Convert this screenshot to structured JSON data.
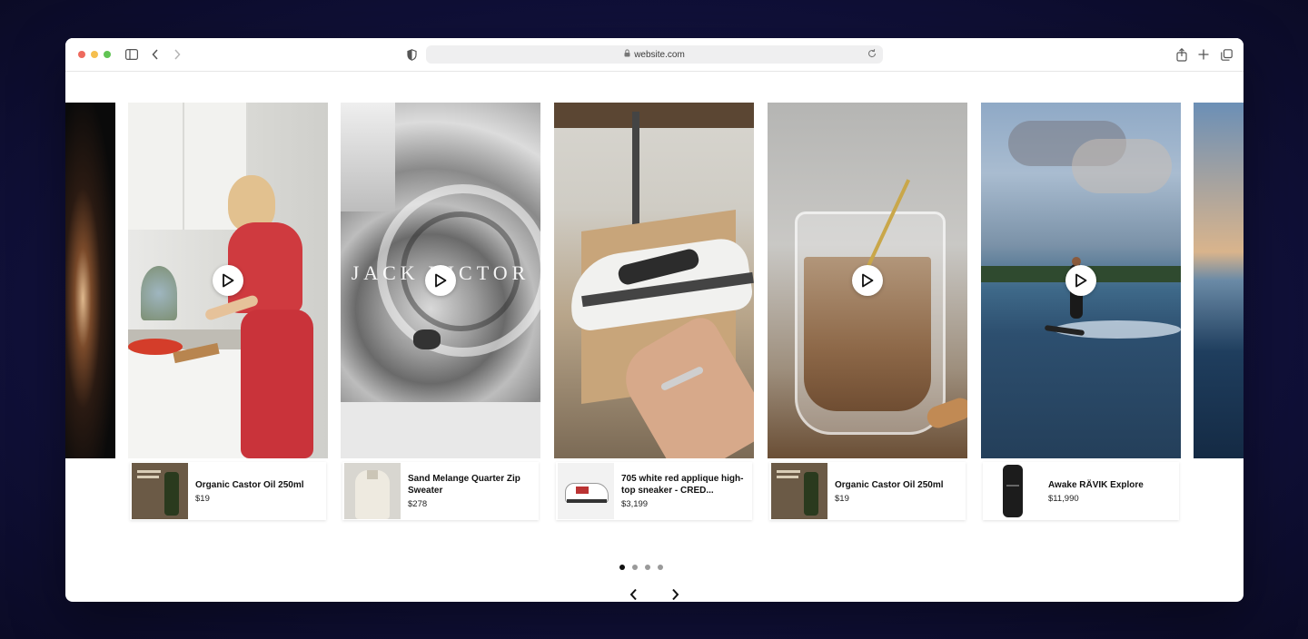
{
  "browser": {
    "url": "website.com",
    "traffic_colors": [
      "#ee6a5e",
      "#f5bf4f",
      "#61c454"
    ]
  },
  "icons": {
    "toolbar": [
      "sidebar-icon",
      "back-icon",
      "forward-icon",
      "shield-icon",
      "lock-icon",
      "reload-icon",
      "share-icon",
      "new-tab-icon",
      "tabs-overview-icon"
    ],
    "carousel": [
      "play-icon",
      "chevron-left-icon",
      "chevron-right-icon"
    ]
  },
  "cards": [
    {
      "media_label": "kitchen-video",
      "overlay_text": "",
      "product": {
        "name": "Organic Castor Oil 250ml",
        "price": "$19"
      }
    },
    {
      "media_label": "staircase-video",
      "overlay_text": "JACK VICTOR",
      "product": {
        "name": "Sand Melange Quarter Zip Sweater",
        "price": "$278"
      }
    },
    {
      "media_label": "sneaker-video",
      "overlay_text": "",
      "product": {
        "name": "705 white red applique high-top sneaker - CRED...",
        "price": "$3,199"
      }
    },
    {
      "media_label": "coffee-video",
      "overlay_text": "",
      "product": {
        "name": "Organic Castor Oil 250ml",
        "price": "$19"
      }
    },
    {
      "media_label": "jetboard-video",
      "overlay_text": "",
      "product": {
        "name": "Awake RÄVIK Explore",
        "price": "$11,990"
      }
    }
  ],
  "pagination": {
    "total": 4,
    "active": 1
  }
}
